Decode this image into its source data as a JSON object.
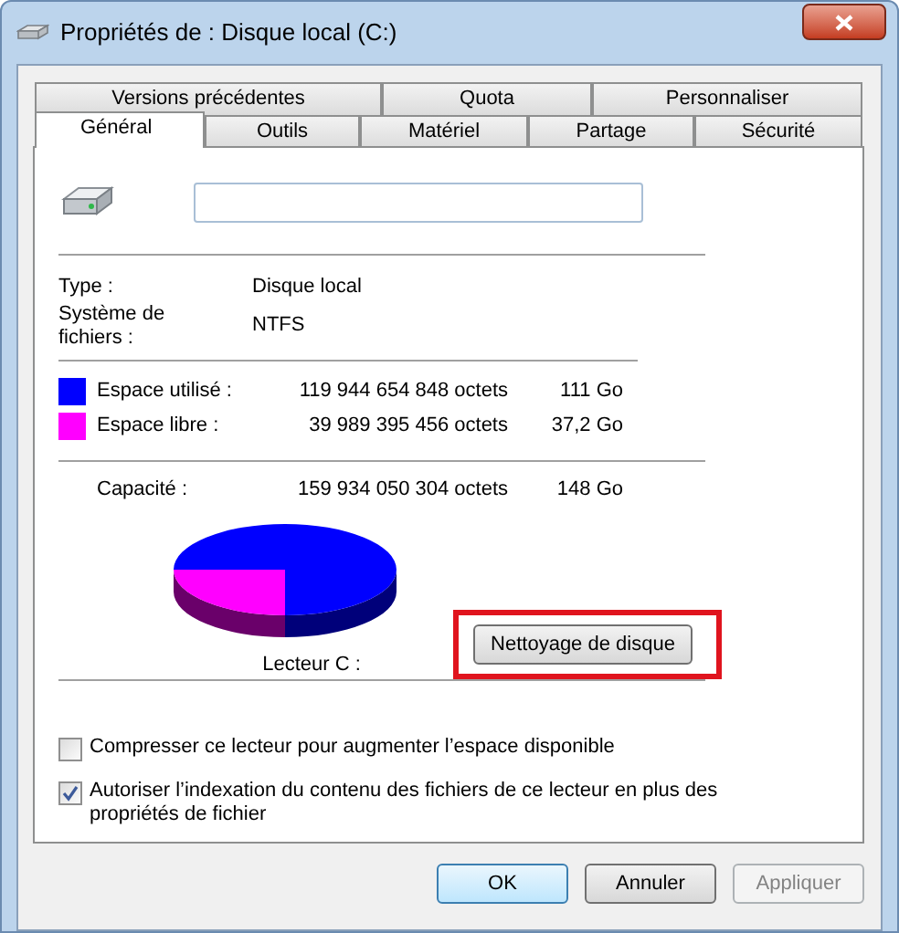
{
  "window": {
    "title": "Propriétés de : Disque local (C:)"
  },
  "tabs_back": [
    {
      "label": "Versions précédentes",
      "selected": false
    },
    {
      "label": "Quota",
      "selected": false
    },
    {
      "label": "Personnaliser",
      "selected": false
    }
  ],
  "tabs_front": [
    {
      "label": "Général",
      "selected": true
    },
    {
      "label": "Outils",
      "selected": false
    },
    {
      "label": "Matériel",
      "selected": false
    },
    {
      "label": "Partage",
      "selected": false
    },
    {
      "label": "Sécurité",
      "selected": false
    }
  ],
  "info": [
    {
      "label": "Type :",
      "value": "Disque local"
    },
    {
      "label": "Système de fichiers :",
      "value": "NTFS"
    }
  ],
  "space": [
    {
      "label": "Espace utilisé :",
      "bytes": "119 944 654 848 octets",
      "size": "111 Go",
      "color": "#0000ff"
    },
    {
      "label": "Espace libre :",
      "bytes": "39 989 395 456 octets",
      "size": "37,2 Go",
      "color": "#ff00ff"
    }
  ],
  "capacity": {
    "label": "Capacité :",
    "bytes": "159 934 050 304 octets",
    "size": "148 Go"
  },
  "drive_label": "Lecteur C :",
  "cleanup_button": {
    "label": "Nettoyage de disque",
    "highlighted": true
  },
  "options": [
    {
      "label": "Compresser ce lecteur pour augmenter l’espace disponible",
      "checked": false
    },
    {
      "label": "Autoriser l’indexation du contenu des fichiers de ce lecteur en plus des propriétés de fichier",
      "checked": true
    }
  ],
  "buttons": [
    {
      "label": "OK",
      "disabled": false,
      "default": true
    },
    {
      "label": "Annuler",
      "disabled": false,
      "default": false
    },
    {
      "label": "Appliquer",
      "disabled": true,
      "default": false
    }
  ]
}
